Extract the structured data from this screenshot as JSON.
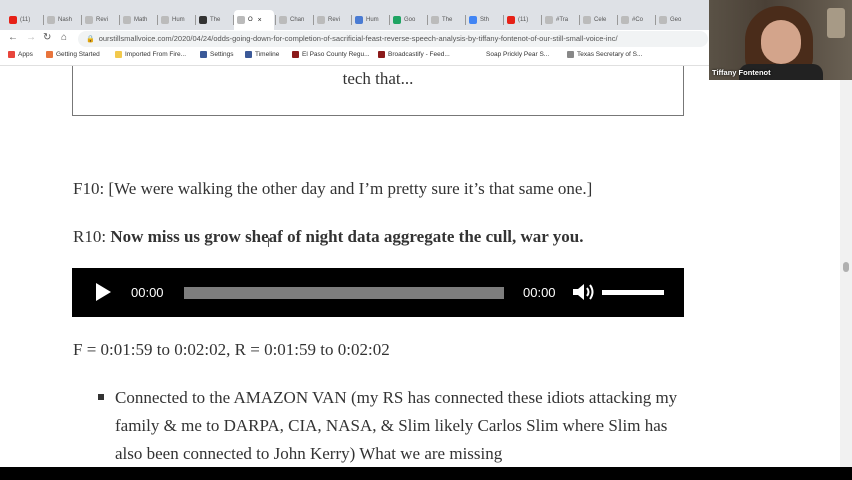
{
  "browser": {
    "tabs": [
      {
        "label": "(11)",
        "color": "#e62117"
      },
      {
        "label": "Nash",
        "color": "#bbbbbb"
      },
      {
        "label": "Revi",
        "color": "#bbbbbb"
      },
      {
        "label": "Math",
        "color": "#bbbbbb"
      },
      {
        "label": "Hum",
        "color": "#bbbbbb"
      },
      {
        "label": "The",
        "color": "#333333"
      },
      {
        "label": "O",
        "color": "#bbbbbb",
        "active": true
      },
      {
        "label": "Chan",
        "color": "#bbbbbb"
      },
      {
        "label": "Revi",
        "color": "#bbbbbb"
      },
      {
        "label": "Hum",
        "color": "#4a7bd3"
      },
      {
        "label": "Goo",
        "color": "#1fa463"
      },
      {
        "label": "The",
        "color": "#bbbbbb"
      },
      {
        "label": "Sth",
        "color": "#4285f4"
      },
      {
        "label": "(11)",
        "color": "#e62117"
      },
      {
        "label": "#Tra",
        "color": "#bbbbbb"
      },
      {
        "label": "Cele",
        "color": "#bbbbbb"
      },
      {
        "label": "#Co",
        "color": "#bbbbbb"
      },
      {
        "label": "Geo",
        "color": "#bbbbbb"
      }
    ],
    "url": "ourstillsmallvoice.com/2020/04/24/odds-going-down-for-completion-of-sacrificial-feast-reverse-speech-analysis-by-tiffany-fontenot-of-our-still-small-voice-inc/",
    "bookmarks": [
      {
        "label": "Apps",
        "color": "#e8453c"
      },
      {
        "label": "Getting Started",
        "color": "#e8743c"
      },
      {
        "label": "Imported From Fire...",
        "color": "#f2c94c"
      },
      {
        "label": "Settings",
        "color": "#3b5998"
      },
      {
        "label": "Timeline",
        "color": "#3b5998"
      },
      {
        "label": "El Paso County Regu...",
        "color": "#8b1a1a"
      },
      {
        "label": "Broadcastify - Feed...",
        "color": "#8b1a1a"
      },
      {
        "label": "Soap Prickly Pear S...",
        "color": "#ffffff"
      },
      {
        "label": "Texas Secretary of S...",
        "color": "#888888"
      }
    ]
  },
  "webcam": {
    "name": "Tiffany Fontenot"
  },
  "content": {
    "box_text": "tech that...",
    "f10": "F10: [We were walking the other day and I’m pretty sure it’s that same one.]",
    "r10_label": "R10: ",
    "r10_text": "Now miss us grow sheaf of night data aggregate the cull, war you.",
    "player": {
      "current_time": "00:00",
      "duration": "00:00",
      "progress": 0,
      "volume": 1
    },
    "timestamps": "F = 0:01:59 to 0:02:02, R = 0:01:59 to 0:02:02",
    "bullet": "Connected to the AMAZON VAN (my RS has connected these idiots attacking my family & me to DARPA, CIA, NASA, & Slim likely Carlos Slim where Slim has also been connected to John Kerry) What we are missing"
  }
}
